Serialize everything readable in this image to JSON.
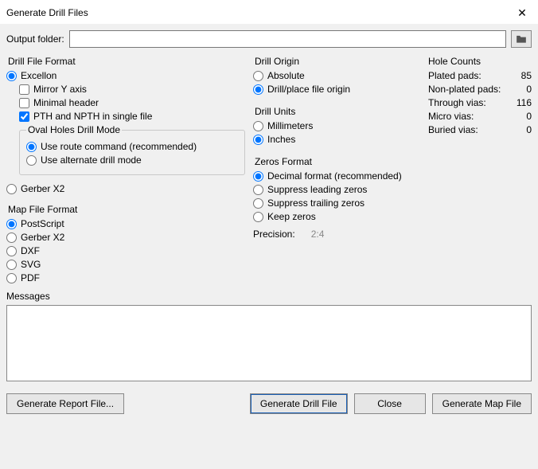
{
  "window": {
    "title": "Generate Drill Files"
  },
  "output": {
    "label": "Output folder:",
    "value": ""
  },
  "drillFileFormat": {
    "title": "Drill File Format",
    "excellon": "Excellon",
    "mirrorY": "Mirror Y axis",
    "minimalHeader": "Minimal header",
    "pthNpthSingle": "PTH and NPTH in single file",
    "ovalHoles": {
      "title": "Oval Holes Drill Mode",
      "route": "Use route command (recommended)",
      "alternate": "Use alternate drill mode"
    },
    "gerberX2": "Gerber X2"
  },
  "mapFileFormat": {
    "title": "Map File Format",
    "postscript": "PostScript",
    "gerberX2": "Gerber X2",
    "dxf": "DXF",
    "svg": "SVG",
    "pdf": "PDF"
  },
  "drillOrigin": {
    "title": "Drill Origin",
    "absolute": "Absolute",
    "fileOrigin": "Drill/place file origin"
  },
  "drillUnits": {
    "title": "Drill Units",
    "mm": "Millimeters",
    "in": "Inches"
  },
  "zerosFormat": {
    "title": "Zeros Format",
    "decimal": "Decimal format (recommended)",
    "suppressLeading": "Suppress leading zeros",
    "suppressTrailing": "Suppress trailing zeros",
    "keepZeros": "Keep zeros"
  },
  "precision": {
    "label": "Precision:",
    "value": "2:4"
  },
  "holeCounts": {
    "title": "Hole Counts",
    "rows": [
      {
        "label": "Plated pads:",
        "value": "85"
      },
      {
        "label": "Non-plated pads:",
        "value": "0"
      },
      {
        "label": "Through vias:",
        "value": "116"
      },
      {
        "label": "Micro vias:",
        "value": "0"
      },
      {
        "label": "Buried vias:",
        "value": "0"
      }
    ]
  },
  "messages": {
    "title": "Messages",
    "value": ""
  },
  "buttons": {
    "report": "Generate Report File...",
    "drill": "Generate Drill File",
    "close": "Close",
    "map": "Generate Map File"
  }
}
